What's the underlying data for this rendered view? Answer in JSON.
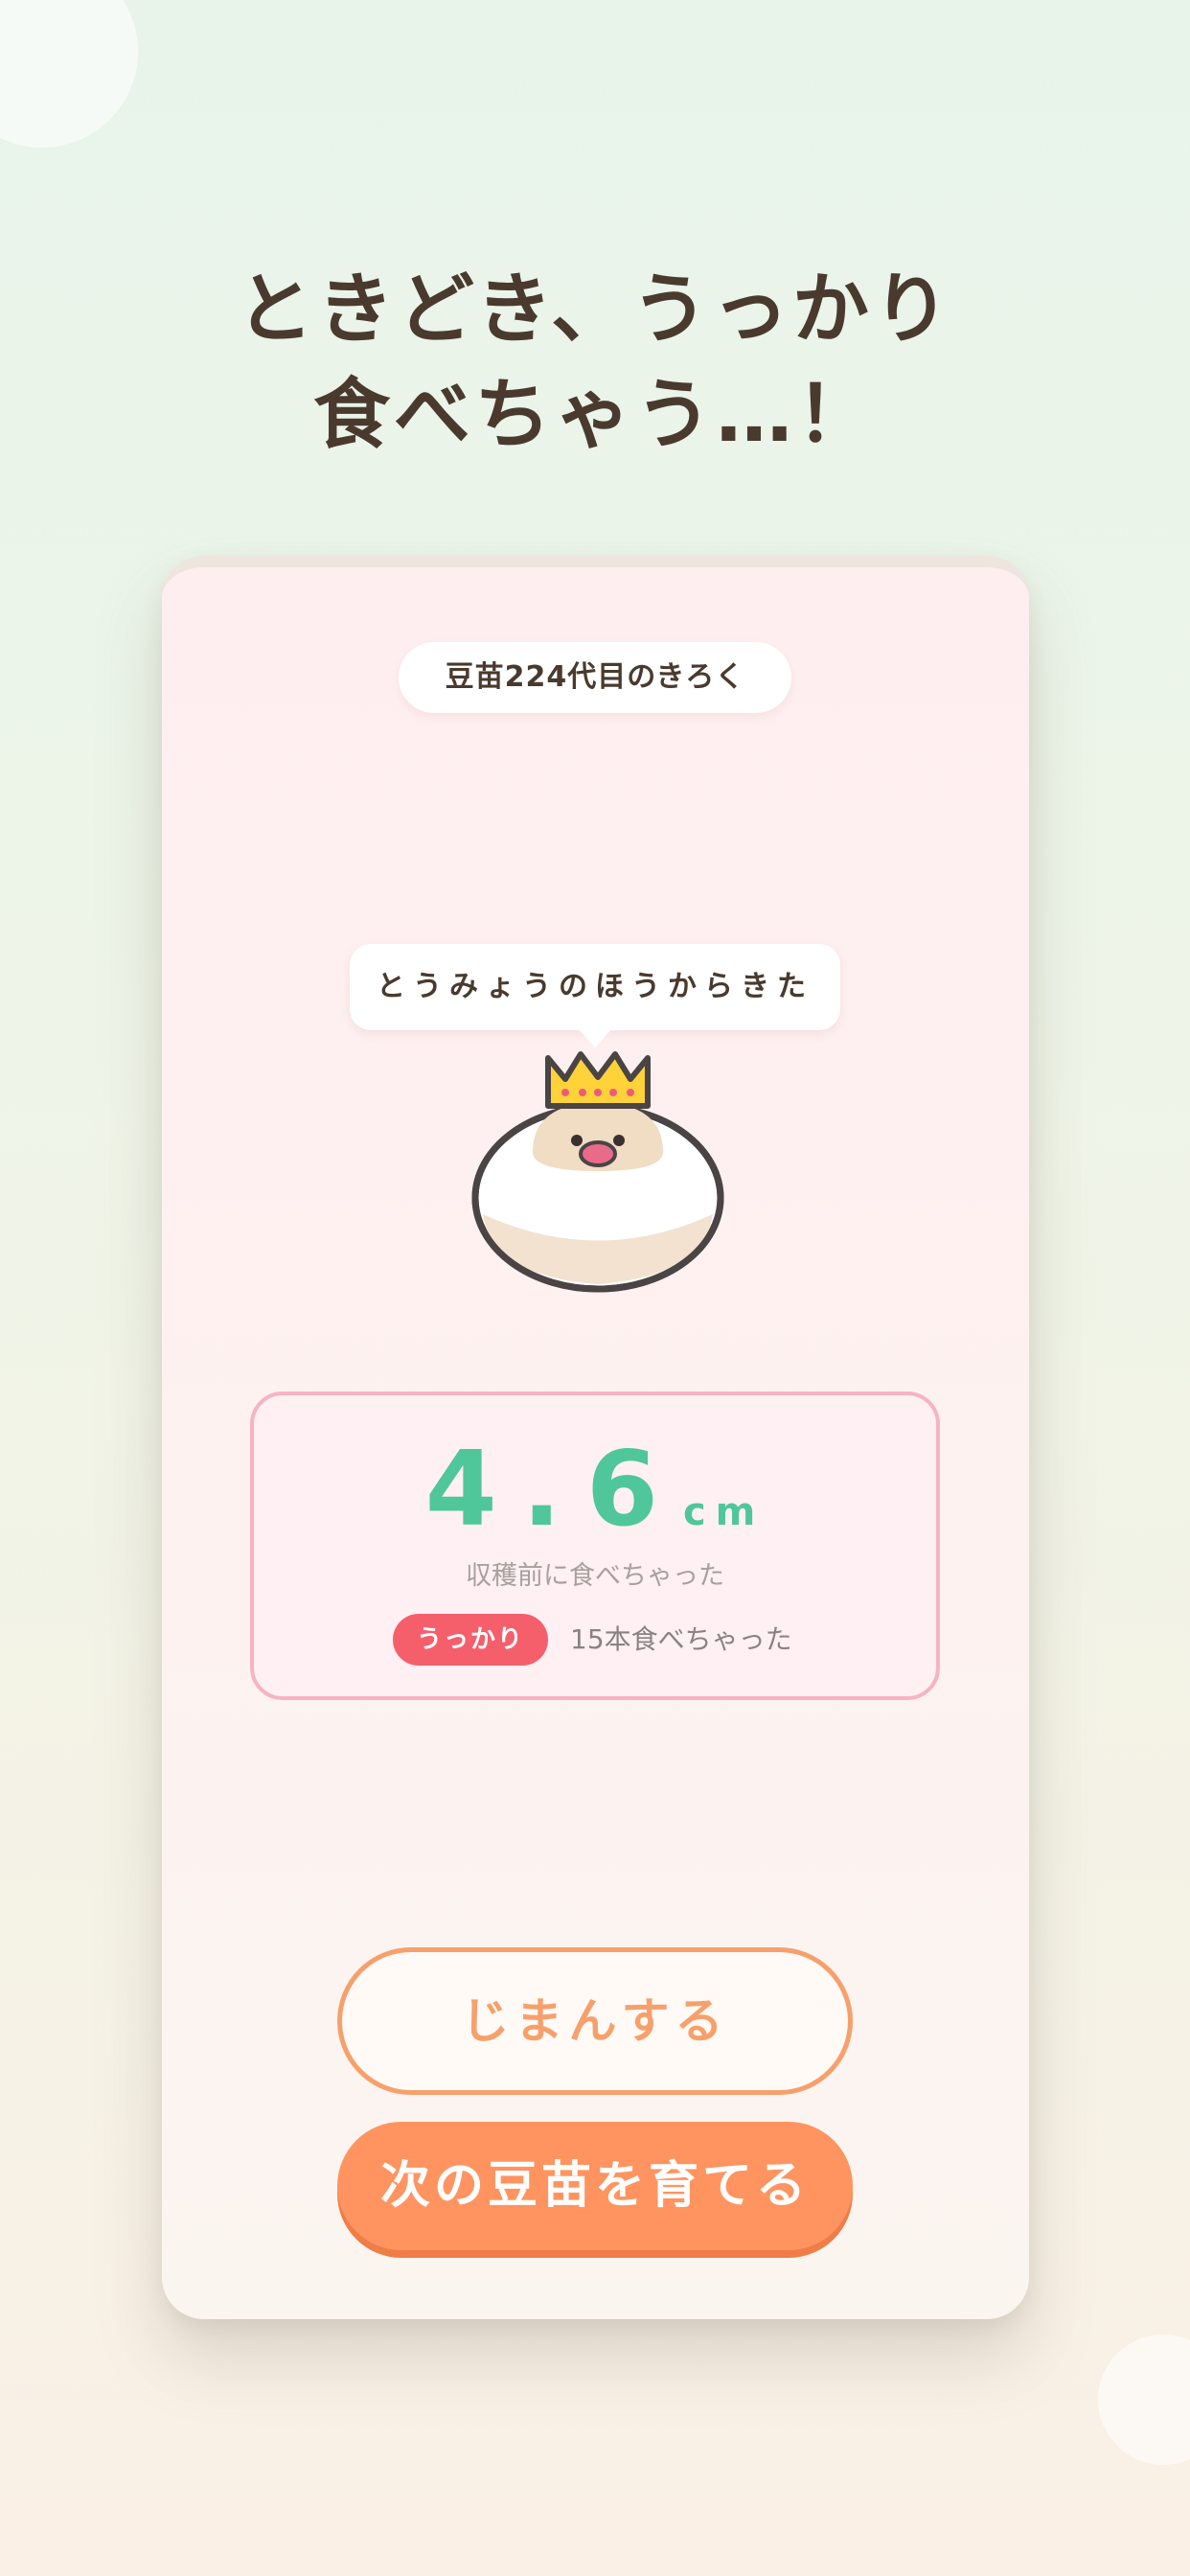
{
  "headline": {
    "line1": "ときどき、うっかり",
    "line2": "食べちゃう…！"
  },
  "card": {
    "generation_label": "豆苗224代目のきろく",
    "speech_bubble": "とうみょうのほうからきた",
    "record": {
      "length_value": "4.6",
      "length_unit": "cm",
      "caption": "収穫前に食べちゃった",
      "badge": "うっかり",
      "eaten_count": "15本食べちゃった"
    },
    "buttons": {
      "brag": "じまんする",
      "next": "次の豆苗を育てる"
    }
  },
  "colors": {
    "accent_green": "#4fc79a",
    "accent_orange": "#ff9460",
    "badge_red": "#f55f6b",
    "record_border_pink": "#f7b3c4",
    "text_brown": "#4a3a2e"
  },
  "icons": {
    "mascot": "bird-with-crown-icon"
  }
}
